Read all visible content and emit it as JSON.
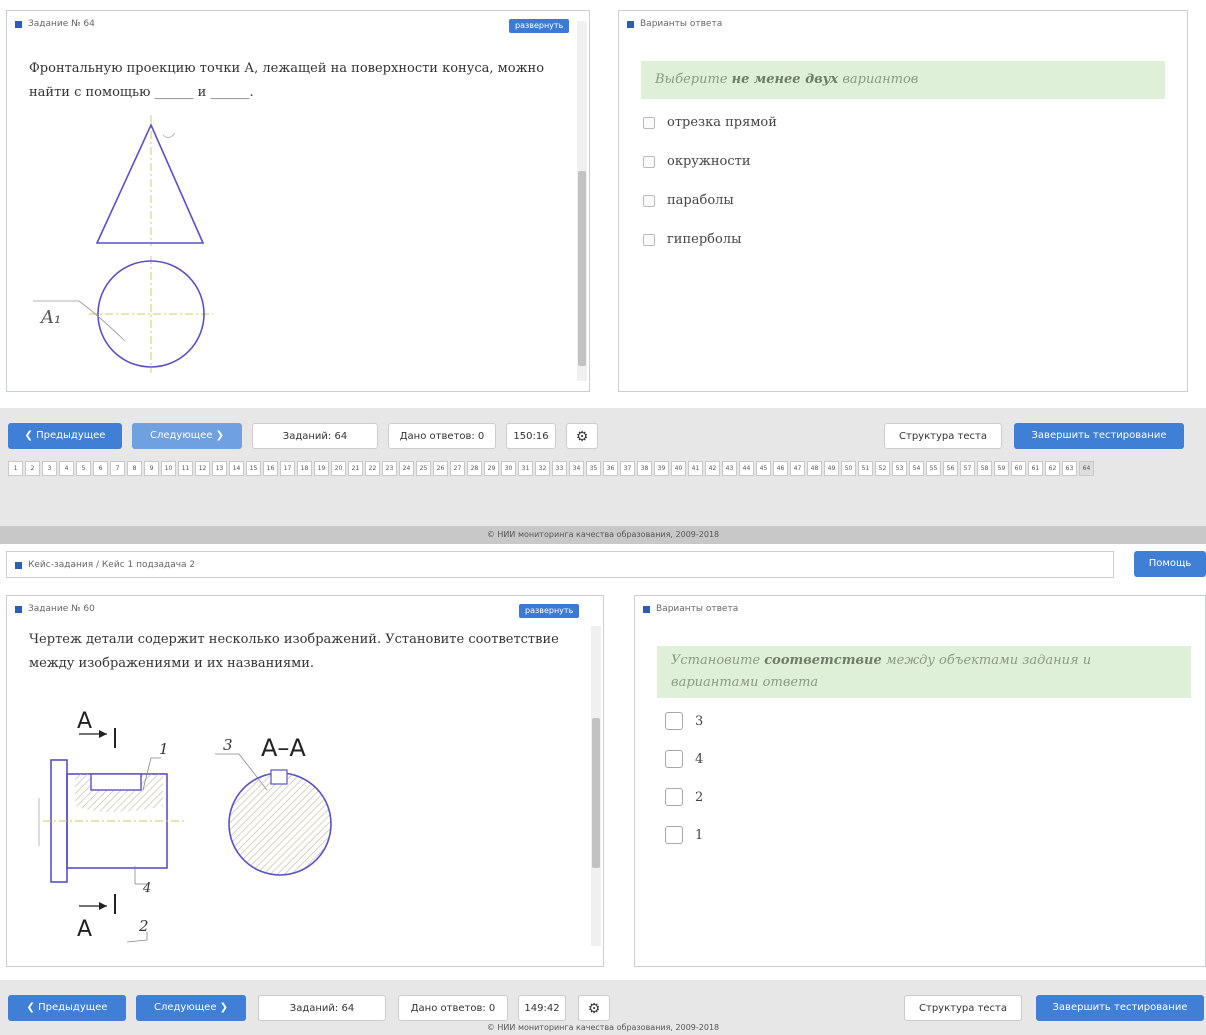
{
  "top": {
    "task_label": "Задание № 64",
    "expand_label": "развернуть",
    "question": "Фронтальную проекцию точки А, лежащей на поверхности конуса, можно найти с помощью ______ и ______.",
    "point_label": "A₁",
    "answers_label": "Варианты ответа",
    "instruction": {
      "pre": "Выберите ",
      "bold": "не менее двух",
      "post": " вариантов"
    },
    "options": [
      "отрезка прямой",
      "окружности",
      "параболы",
      "гиперболы"
    ],
    "nav": {
      "prev": "❮ Предыдущее",
      "next": "Следующее ❯",
      "tasks": "Заданий: 64",
      "answered": "Дано ответов: 0",
      "timer": "150:16",
      "structure": "Структура теста",
      "finish": "Завершить тестирование"
    },
    "pages": [
      "1",
      "2",
      "3",
      "4",
      "5",
      "6",
      "7",
      "8",
      "9",
      "10",
      "11",
      "12",
      "13",
      "14",
      "15",
      "16",
      "17",
      "18",
      "19",
      "20",
      "21",
      "22",
      "23",
      "24",
      "25",
      "26",
      "27",
      "28",
      "29",
      "30",
      "31",
      "32",
      "33",
      "34",
      "35",
      "36",
      "37",
      "38",
      "39",
      "40",
      "41",
      "42",
      "43",
      "44",
      "45",
      "46",
      "47",
      "48",
      "49",
      "50",
      "51",
      "52",
      "53",
      "54",
      "55",
      "56",
      "57",
      "58",
      "59",
      "60",
      "61",
      "62",
      "63",
      "64"
    ],
    "current_page": "64",
    "footer": "© НИИ мониторинга качества образования, 2009-2018"
  },
  "bottom": {
    "breadcrumb": "Кейс-задания / Кейс 1 подзадача 2",
    "help": "Помощь",
    "task_label": "Задание № 60",
    "expand_label": "развернуть",
    "question": "Чертеж детали содержит несколько изображений. Установите соответствие между изображениями и их названиями.",
    "drawing_labels": {
      "a_top": "A",
      "a_bottom": "A",
      "section": "A–A",
      "n1": "1",
      "n2": "2",
      "n3": "3",
      "n4": "4"
    },
    "answers_label": "Варианты ответа",
    "instruction": {
      "pre": "Установите ",
      "bold": "соответствие",
      "post": " между объектами задания и вариантами ответа"
    },
    "options": [
      "3",
      "4",
      "2",
      "1"
    ],
    "nav": {
      "prev": "❮ Предыдущее",
      "next": "Следующее ❯",
      "tasks": "Заданий: 64",
      "answered": "Дано ответов: 0",
      "timer": "149:42",
      "structure": "Структура теста",
      "finish": "Завершить тестирование"
    },
    "footer": "© НИИ мониторинга качества образования, 2009-2018"
  },
  "colors": {
    "accent": "#3f7fd6",
    "drawing": "#5a50c8",
    "instruction_bg": "#dff0d8"
  },
  "icons": {
    "settings": "gear-icon",
    "section_marker": "square-icon"
  }
}
